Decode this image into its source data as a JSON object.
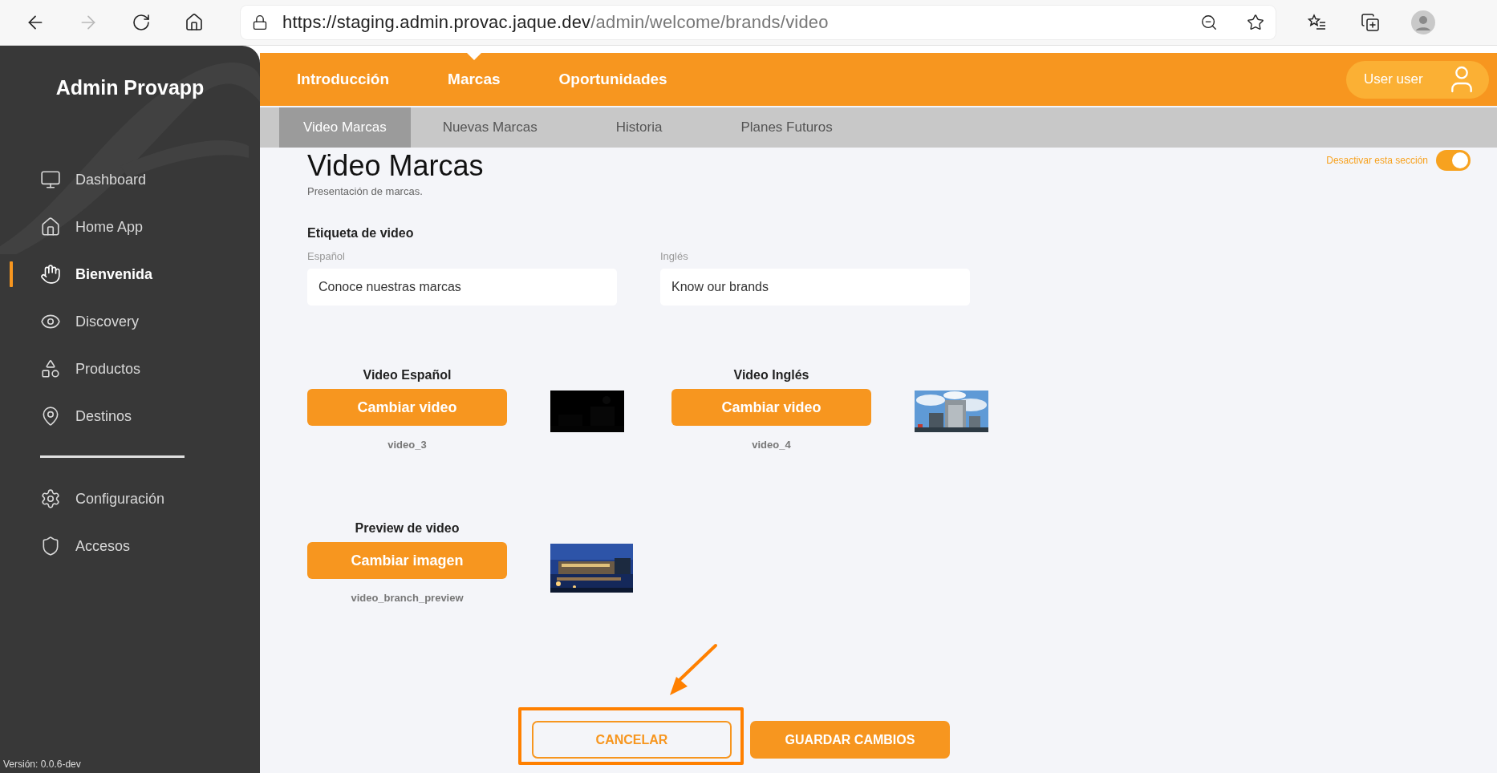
{
  "browser": {
    "url_host": "https://staging.admin.provac.jaque.dev",
    "url_path": "/admin/welcome/brands/video",
    "forward_disabled": true
  },
  "sidebar": {
    "title": "Admin Provapp",
    "items": [
      {
        "label": "Dashboard",
        "selected": false
      },
      {
        "label": "Home App",
        "selected": false
      },
      {
        "label": "Bienvenida",
        "selected": true
      },
      {
        "label": "Discovery",
        "selected": false
      },
      {
        "label": "Productos",
        "selected": false
      },
      {
        "label": "Destinos",
        "selected": false
      }
    ],
    "secondary_items": [
      {
        "label": "Configuración",
        "selected": false
      },
      {
        "label": "Accesos",
        "selected": false
      }
    ],
    "version": "Versión: 0.0.6-dev"
  },
  "header": {
    "nav": [
      {
        "label": "Introducción",
        "selected": false
      },
      {
        "label": "Marcas",
        "selected": true
      },
      {
        "label": "Oportunidades",
        "selected": false
      }
    ],
    "user": "User user"
  },
  "subtabs": [
    {
      "label": "Video Marcas",
      "selected": true
    },
    {
      "label": "Nuevas Marcas",
      "selected": false
    },
    {
      "label": "Historia",
      "selected": false
    },
    {
      "label": "Planes Futuros",
      "selected": false
    }
  ],
  "page": {
    "title": "Video Marcas",
    "subtitle": "Presentación de marcas.",
    "section_toggle": {
      "label": "Desactivar esta sección",
      "on": true
    }
  },
  "video_label": {
    "heading": "Etiqueta de video",
    "fields": [
      {
        "label": "Español",
        "value": "Conoce nuestras marcas"
      },
      {
        "label": "Inglés",
        "value": "Know our brands"
      }
    ]
  },
  "media": [
    {
      "heading": "Video Español",
      "button": "Cambiar video",
      "file": "video_3"
    },
    {
      "heading": "Video Inglés",
      "button": "Cambiar video",
      "file": "video_4"
    },
    {
      "heading": "Preview de video",
      "button": "Cambiar imagen",
      "file": "video_branch_preview"
    }
  ],
  "actions": [
    {
      "label": "CANCELAR",
      "kind": "outline",
      "highlighted": true
    },
    {
      "label": "GUARDAR CAMBIOS",
      "kind": "filled",
      "highlighted": false
    }
  ]
}
